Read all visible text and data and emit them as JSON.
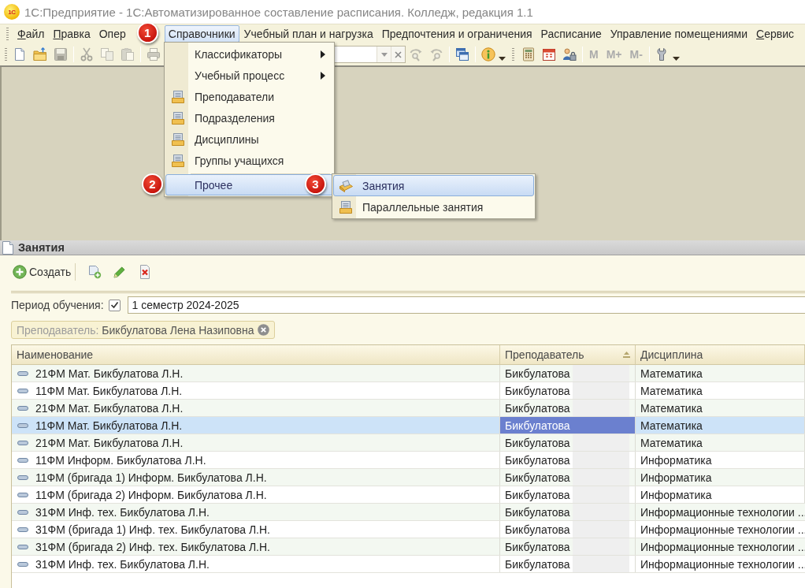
{
  "window": {
    "logo": "1С",
    "title": "1С:Предприятие - 1С:Автоматизированное составление расписания. Колледж, редакция 1.1"
  },
  "menu_bar": {
    "items": [
      {
        "label": "Файл",
        "mnemonic": true,
        "selected": false
      },
      {
        "label": "Правка",
        "mnemonic": true,
        "selected": false
      },
      {
        "label": "Опер",
        "mnemonic": false,
        "selected": false
      },
      {
        "label": "Справочники",
        "mnemonic": false,
        "selected": true,
        "badge": "1"
      },
      {
        "label": "Учебный план и нагрузка",
        "mnemonic": false,
        "selected": false
      },
      {
        "label": "Предпочтения и ограничения",
        "mnemonic": false,
        "selected": false
      },
      {
        "label": "Расписание",
        "mnemonic": false,
        "selected": false
      },
      {
        "label": "Управление помещениями",
        "mnemonic": false,
        "selected": false
      },
      {
        "label": "Сервис",
        "mnemonic": true,
        "selected": false
      }
    ]
  },
  "toolbar": {
    "items": [
      {
        "kind": "icon",
        "disabled": false
      },
      {
        "kind": "icon",
        "disabled": false
      },
      {
        "kind": "icon",
        "disabled": true
      },
      {
        "kind": "separator"
      },
      {
        "kind": "icon",
        "disabled": true
      },
      {
        "kind": "icon",
        "disabled": true
      },
      {
        "kind": "icon",
        "disabled": true
      },
      {
        "kind": "separator"
      },
      {
        "kind": "icon",
        "disabled": true
      },
      {
        "kind": "search"
      },
      {
        "kind": "icon",
        "disabled": true
      },
      {
        "kind": "icon",
        "disabled": true
      },
      {
        "kind": "separator"
      },
      {
        "kind": "icon",
        "disabled": false
      },
      {
        "kind": "separator"
      },
      {
        "kind": "icon_menu",
        "disabled": false
      },
      {
        "kind": "grip"
      },
      {
        "kind": "icon",
        "disabled": false
      },
      {
        "kind": "icon",
        "disabled": false
      },
      {
        "kind": "icon",
        "disabled": false
      },
      {
        "kind": "separator"
      },
      {
        "kind": "text",
        "label": "M",
        "disabled": true
      },
      {
        "kind": "text",
        "label": "M+",
        "disabled": true
      },
      {
        "kind": "text",
        "label": "M-",
        "disabled": true
      },
      {
        "kind": "separator"
      },
      {
        "kind": "icon_menu",
        "disabled": false
      }
    ]
  },
  "menu": {
    "groups": [
      {
        "items": [
          {
            "label": "Классификаторы",
            "kind": "submenu",
            "selected": false
          },
          {
            "label": "Учебный процесс",
            "kind": "submenu",
            "selected": false
          },
          {
            "label": "Преподаватели",
            "kind": "catalog",
            "selected": false
          },
          {
            "label": "Подразделения",
            "kind": "catalog",
            "selected": false
          },
          {
            "label": "Дисциплины",
            "kind": "catalog",
            "selected": false
          },
          {
            "label": "Группы учащихся",
            "kind": "catalog",
            "selected": false
          }
        ]
      },
      {
        "items": [
          {
            "label": "Прочее",
            "kind": "plain",
            "selected": true,
            "badge": "2"
          }
        ]
      }
    ]
  },
  "submenu": {
    "items": [
      {
        "label": "Занятия",
        "selected": true,
        "badge": "3"
      },
      {
        "label": "Параллельные занятия",
        "selected": false
      }
    ]
  },
  "form": {
    "title": "Занятия",
    "create_button": "Создать",
    "period": {
      "label": "Период обучения:",
      "checked": true,
      "value": "1 семестр 2024-2025"
    },
    "filter": {
      "label": "Преподаватель:",
      "value": "Бикбулатова Лена Назиповна"
    },
    "table": {
      "columns": [
        {
          "label": "Наименование",
          "sorted": false,
          "current": false
        },
        {
          "label": "Преподаватель",
          "sorted": true,
          "current": true
        },
        {
          "label": "Дисциплина",
          "sorted": false,
          "current": false
        }
      ],
      "rows": [
        {
          "name": "21ФМ Мат. Бикбулатова Л.Н.",
          "teacher": "Бикбулатова",
          "discipline": "Математика",
          "selected": false
        },
        {
          "name": "11ФМ Мат. Бикбулатова Л.Н.",
          "teacher": "Бикбулатова",
          "discipline": "Математика",
          "selected": false
        },
        {
          "name": "21ФМ Мат. Бикбулатова Л.Н.",
          "teacher": "Бикбулатова",
          "discipline": "Математика",
          "selected": false
        },
        {
          "name": "11ФМ Мат. Бикбулатова Л.Н.",
          "teacher": "Бикбулатова",
          "discipline": "Математика",
          "selected": true
        },
        {
          "name": "21ФМ Мат. Бикбулатова Л.Н.",
          "teacher": "Бикбулатова",
          "discipline": "Математика",
          "selected": false
        },
        {
          "name": "11ФМ Информ. Бикбулатова Л.Н.",
          "teacher": "Бикбулатова",
          "discipline": "Информатика",
          "selected": false
        },
        {
          "name": "11ФМ (бригада 1) Информ. Бикбулатова Л.Н.",
          "teacher": "Бикбулатова",
          "discipline": "Информатика",
          "selected": false
        },
        {
          "name": "11ФМ (бригада 2) Информ. Бикбулатова Л.Н.",
          "teacher": "Бикбулатова",
          "discipline": "Информатика",
          "selected": false
        },
        {
          "name": "31ФМ Инф. тех. Бикбулатова Л.Н.",
          "teacher": "Бикбулатова",
          "discipline": "Информационные технологии ...",
          "selected": false
        },
        {
          "name": "31ФМ (бригада 1) Инф. тех. Бикбулатова Л.Н.",
          "teacher": "Бикбулатова",
          "discipline": "Информационные технологии ...",
          "selected": false
        },
        {
          "name": "31ФМ (бригада 2) Инф. тех. Бикбулатова Л.Н.",
          "teacher": "Бикбулатова",
          "discipline": "Информационные технологии ...",
          "selected": false
        },
        {
          "name": "31ФМ Инф. тех. Бикбулатова Л.Н.",
          "teacher": "Бикбулатова",
          "discipline": "Информационные технологии ...",
          "selected": false
        }
      ]
    }
  }
}
